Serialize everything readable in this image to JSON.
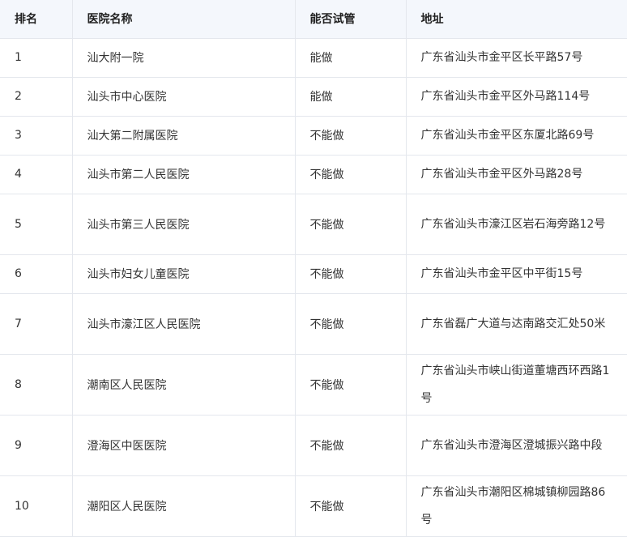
{
  "table": {
    "headers": [
      "排名",
      "医院名称",
      "能否试管",
      "地址"
    ],
    "rows": [
      {
        "rank": "1",
        "name": "汕大附一院",
        "ivf": "能做",
        "address": "广东省汕头市金平区长平路57号"
      },
      {
        "rank": "2",
        "name": "汕头市中心医院",
        "ivf": "能做",
        "address": "广东省汕头市金平区外马路114号"
      },
      {
        "rank": "3",
        "name": "汕大第二附属医院",
        "ivf": "不能做",
        "address": "广东省汕头市金平区东厦北路69号"
      },
      {
        "rank": "4",
        "name": "汕头市第二人民医院",
        "ivf": "不能做",
        "address": "广东省汕头市金平区外马路28号"
      },
      {
        "rank": "5",
        "name": "汕头市第三人民医院",
        "ivf": "不能做",
        "address": "广东省汕头市濠江区岩石海旁路12号"
      },
      {
        "rank": "6",
        "name": "汕头市妇女儿童医院",
        "ivf": "不能做",
        "address": "广东省汕头市金平区中平街15号"
      },
      {
        "rank": "7",
        "name": "汕头市濠江区人民医院",
        "ivf": "不能做",
        "address": "广东省磊广大道与达南路交汇处50米"
      },
      {
        "rank": "8",
        "name": "潮南区人民医院",
        "ivf": "不能做",
        "address": "广东省汕头市峡山街道董塘西环西路1号"
      },
      {
        "rank": "9",
        "name": "澄海区中医医院",
        "ivf": "不能做",
        "address": "广东省汕头市澄海区澄城振兴路中段"
      },
      {
        "rank": "10",
        "name": "潮阳区人民医院",
        "ivf": "不能做",
        "address": "广东省汕头市潮阳区棉城镇柳园路86号"
      }
    ]
  }
}
